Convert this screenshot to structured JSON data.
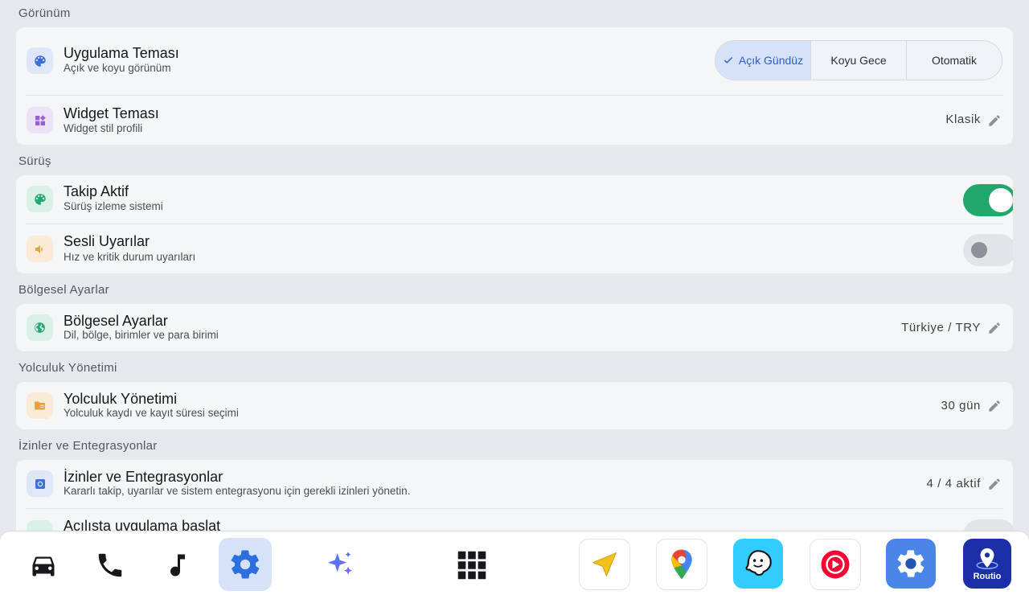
{
  "sections": {
    "appearance": "Görünüm",
    "driving": "Sürüş",
    "regional": "Bölgesel Ayarlar",
    "trips": "Yolculuk Yönetimi",
    "permissions": "İzinler ve Entegrasyonlar"
  },
  "appearance": {
    "theme": {
      "title": "Uygulama Teması",
      "subtitle": "Açık ve koyu görünüm",
      "options": [
        "Açık Gündüz",
        "Koyu Gece",
        "Otomatik"
      ],
      "selected": "Açık Gündüz"
    },
    "widget": {
      "title": "Widget Teması",
      "subtitle": "Widget stil profili",
      "value": "Klasik"
    }
  },
  "driving": {
    "tracking": {
      "title": "Takip Aktif",
      "subtitle": "Sürüş izleme sistemi",
      "enabled": true
    },
    "voice": {
      "title": "Sesli Uyarılar",
      "subtitle": "Hız ve kritik durum uyarıları",
      "enabled": false
    }
  },
  "regional": {
    "title": "Bölgesel Ayarlar",
    "subtitle": "Dil, bölge, birimler ve para birimi",
    "value": "Türkiye / TRY"
  },
  "trips": {
    "title": "Yolculuk Yönetimi",
    "subtitle": "Yolculuk kaydı ve kayıt süresi seçimi",
    "value": "30 gün"
  },
  "permissions": {
    "title": "İzinler ve Entegrasyonlar",
    "subtitle": "Kararlı takip, uyarılar ve sistem entegrasyonu için gerekli izinleri yönetin.",
    "value": "4 / 4 aktif",
    "next_title": "Açılışta uygulama başlat"
  },
  "dock": {
    "items": [
      "car-icon",
      "phone-icon",
      "music-icon",
      "settings-icon",
      "ai-sparkle-icon",
      "app-grid-icon"
    ],
    "active": "settings-icon",
    "apps": [
      "navigation-app",
      "maps-app",
      "waze-app",
      "youtube-music-app",
      "settings-app",
      "routio-app"
    ],
    "routio_label": "Routio"
  },
  "colors": {
    "accent": "#2c5fc6",
    "toggle_on": "#1fa86a",
    "toggle_off": "#e2e4e8",
    "background": "#e6e8ec",
    "card": "#f5f6f8"
  }
}
